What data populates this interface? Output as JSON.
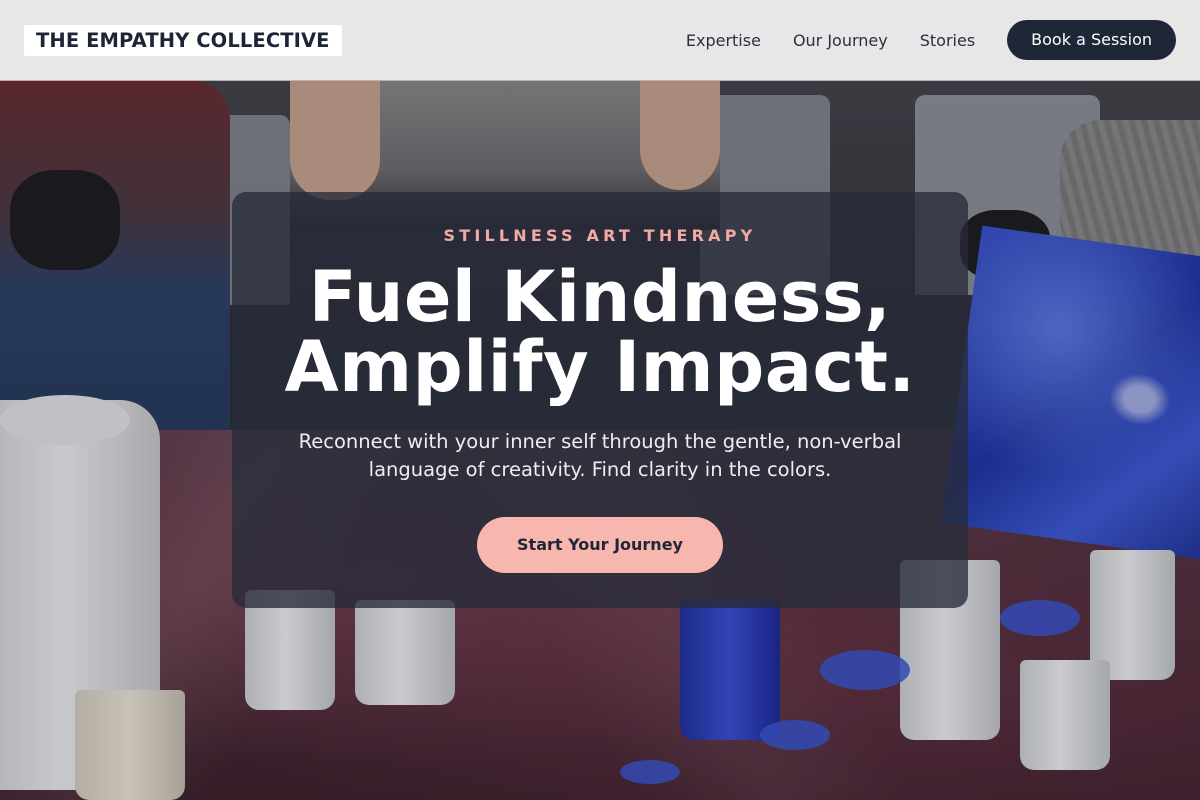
{
  "brand": {
    "name": "THE EMPATHY COLLECTIVE"
  },
  "nav": {
    "links": [
      {
        "label": "Expertise"
      },
      {
        "label": "Our Journey"
      },
      {
        "label": "Stories"
      }
    ],
    "cta_label": "Book a Session"
  },
  "hero": {
    "eyebrow": "STILLNESS ART THERAPY",
    "headline_line1": "Fuel Kindness,",
    "headline_line2": "Amplify Impact.",
    "subtext": "Reconnect with your inner self through the gentle, non-verbal language of creativity. Find clarity in the colors.",
    "cta_label": "Start Your Journey"
  },
  "colors": {
    "navy": "#1f2638",
    "accent_pink": "#f7b6ae",
    "eyebrow_pink": "#f4aaa4",
    "card_bg": "rgba(40,44,58,0.78)"
  }
}
